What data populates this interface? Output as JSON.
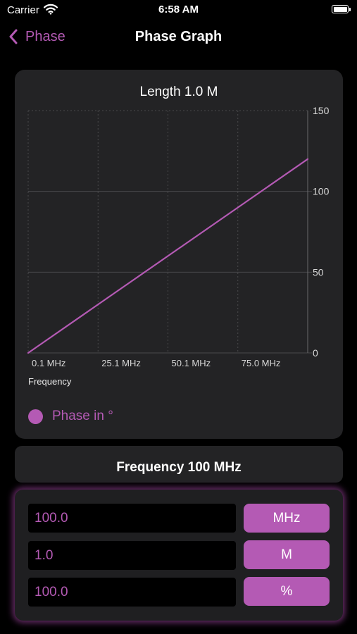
{
  "status_bar": {
    "carrier": "Carrier",
    "time": "6:58 AM",
    "icons": [
      "wifi-icon",
      "battery-icon"
    ]
  },
  "nav": {
    "back_label": "Phase",
    "title": "Phase Graph",
    "icons": [
      "chevron-left-icon"
    ]
  },
  "accent_color": "#b45ab4",
  "chart_data": {
    "type": "line",
    "title": "Length 1.0 M",
    "xlabel": "Frequency",
    "x_tick_labels": [
      "0.1 MHz",
      "25.1 MHz",
      "50.1 MHz",
      "75.0 MHz"
    ],
    "y_tick_labels": [
      "0",
      "50",
      "100",
      "150"
    ],
    "xlim": [
      0.1,
      100
    ],
    "ylim": [
      0,
      150
    ],
    "y_axis_position": "right",
    "grid": true,
    "legend_position": "bottom-left",
    "series": [
      {
        "name": "Phase in °",
        "color": "#b45ab4",
        "x": [
          0.1,
          100
        ],
        "y": [
          0,
          120
        ]
      }
    ]
  },
  "frequency_display": "Frequency 100 MHz",
  "inputs": [
    {
      "value": "100.0",
      "unit": "MHz"
    },
    {
      "value": "1.0",
      "unit": "M"
    },
    {
      "value": "100.0",
      "unit": "%"
    }
  ]
}
